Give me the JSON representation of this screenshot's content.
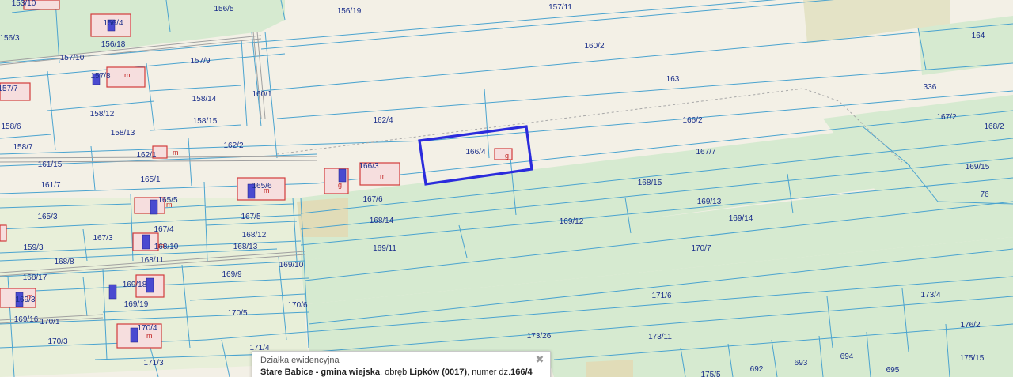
{
  "map": {
    "parcel_labels": [
      {
        "id": "153-10",
        "text": "153/10"
      },
      {
        "id": "156-5",
        "text": "156/5"
      },
      {
        "id": "156-19",
        "text": "156/19"
      },
      {
        "id": "157-11",
        "text": "157/11"
      },
      {
        "id": "156-3",
        "text": "156/3"
      },
      {
        "id": "156-4",
        "text": "156/4"
      },
      {
        "id": "156-18",
        "text": "156/18"
      },
      {
        "id": "164",
        "text": "164"
      },
      {
        "id": "160-2",
        "text": "160/2"
      },
      {
        "id": "157-10",
        "text": "157/10"
      },
      {
        "id": "157-9",
        "text": "157/9"
      },
      {
        "id": "157-8",
        "text": "157/8"
      },
      {
        "id": "163",
        "text": "163"
      },
      {
        "id": "157-7",
        "text": "157/7"
      },
      {
        "id": "160-1",
        "text": "160/1"
      },
      {
        "id": "336",
        "text": "336"
      },
      {
        "id": "158-14",
        "text": "158/14"
      },
      {
        "id": "158-12",
        "text": "158/12"
      },
      {
        "id": "162-4",
        "text": "162/4"
      },
      {
        "id": "166-2",
        "text": "166/2"
      },
      {
        "id": "167-2",
        "text": "167/2"
      },
      {
        "id": "168-2",
        "text": "168/2"
      },
      {
        "id": "158-6",
        "text": "158/6"
      },
      {
        "id": "158-15",
        "text": "158/15"
      },
      {
        "id": "158-13",
        "text": "158/13"
      },
      {
        "id": "166-4",
        "text": "166/4"
      },
      {
        "id": "158-7",
        "text": "158/7"
      },
      {
        "id": "162-2",
        "text": "162/2"
      },
      {
        "id": "167-7",
        "text": "167/7"
      },
      {
        "id": "162-1",
        "text": "162/1"
      },
      {
        "id": "161-15",
        "text": "161/15"
      },
      {
        "id": "166-3",
        "text": "166/3"
      },
      {
        "id": "169-15",
        "text": "169/15"
      },
      {
        "id": "165-1",
        "text": "165/1"
      },
      {
        "id": "161-7",
        "text": "161/7"
      },
      {
        "id": "165-6",
        "text": "165/6"
      },
      {
        "id": "168-15",
        "text": "168/15"
      },
      {
        "id": "76",
        "text": "76"
      },
      {
        "id": "165-5",
        "text": "165/5"
      },
      {
        "id": "167-6",
        "text": "167/6"
      },
      {
        "id": "169-13",
        "text": "169/13"
      },
      {
        "id": "165-3",
        "text": "165/3"
      },
      {
        "id": "167-5",
        "text": "167/5"
      },
      {
        "id": "168-14",
        "text": "168/14"
      },
      {
        "id": "169-12",
        "text": "169/12"
      },
      {
        "id": "169-14",
        "text": "169/14"
      },
      {
        "id": "167-4",
        "text": "167/4"
      },
      {
        "id": "167-3",
        "text": "167/3"
      },
      {
        "id": "168-12",
        "text": "168/12"
      },
      {
        "id": "159-3",
        "text": "159/3"
      },
      {
        "id": "168-10",
        "text": "168/10"
      },
      {
        "id": "168-13",
        "text": "168/13"
      },
      {
        "id": "169-11",
        "text": "169/11"
      },
      {
        "id": "170-7",
        "text": "170/7"
      },
      {
        "id": "168-8",
        "text": "168/8"
      },
      {
        "id": "168-11",
        "text": "168/11"
      },
      {
        "id": "169-10",
        "text": "169/10"
      },
      {
        "id": "168-17",
        "text": "168/17"
      },
      {
        "id": "169-9",
        "text": "169/9"
      },
      {
        "id": "169-18",
        "text": "169/18"
      },
      {
        "id": "171-6",
        "text": "171/6"
      },
      {
        "id": "173-4",
        "text": "173/4"
      },
      {
        "id": "169-3",
        "text": "169/3"
      },
      {
        "id": "169-19",
        "text": "169/19"
      },
      {
        "id": "170-6",
        "text": "170/6"
      },
      {
        "id": "170-5",
        "text": "170/5"
      },
      {
        "id": "169-16",
        "text": "169/16"
      },
      {
        "id": "170-1",
        "text": "170/1"
      },
      {
        "id": "170-4",
        "text": "170/4"
      },
      {
        "id": "176-2",
        "text": "176/2"
      },
      {
        "id": "173-26",
        "text": "173/26"
      },
      {
        "id": "173-11",
        "text": "173/11"
      },
      {
        "id": "170-3",
        "text": "170/3"
      },
      {
        "id": "171-4",
        "text": "171/4"
      },
      {
        "id": "694",
        "text": "694"
      },
      {
        "id": "175-15",
        "text": "175/15"
      },
      {
        "id": "171-3",
        "text": "171/3"
      },
      {
        "id": "693",
        "text": "693"
      },
      {
        "id": "692",
        "text": "692"
      },
      {
        "id": "695",
        "text": "695"
      },
      {
        "id": "175-5",
        "text": "175/5"
      }
    ],
    "building_marks": [
      "m",
      "g"
    ],
    "colors": {
      "background": "#f3f0e6",
      "meadow": "#d6ead0",
      "boundary": "#4aa3cf",
      "building": "#d23b3b",
      "highlight": "#2b2bdc",
      "label": "#1a2e8a"
    }
  },
  "popup": {
    "title": "Działka ewidencyjna",
    "gmina": "Stare Babice - gmina wiejska",
    "sep1": ", obręb ",
    "obreb": "Lipków (0017)",
    "sep2": ", numer dz.",
    "numer": "166/4",
    "close_icon": "close-icon"
  }
}
